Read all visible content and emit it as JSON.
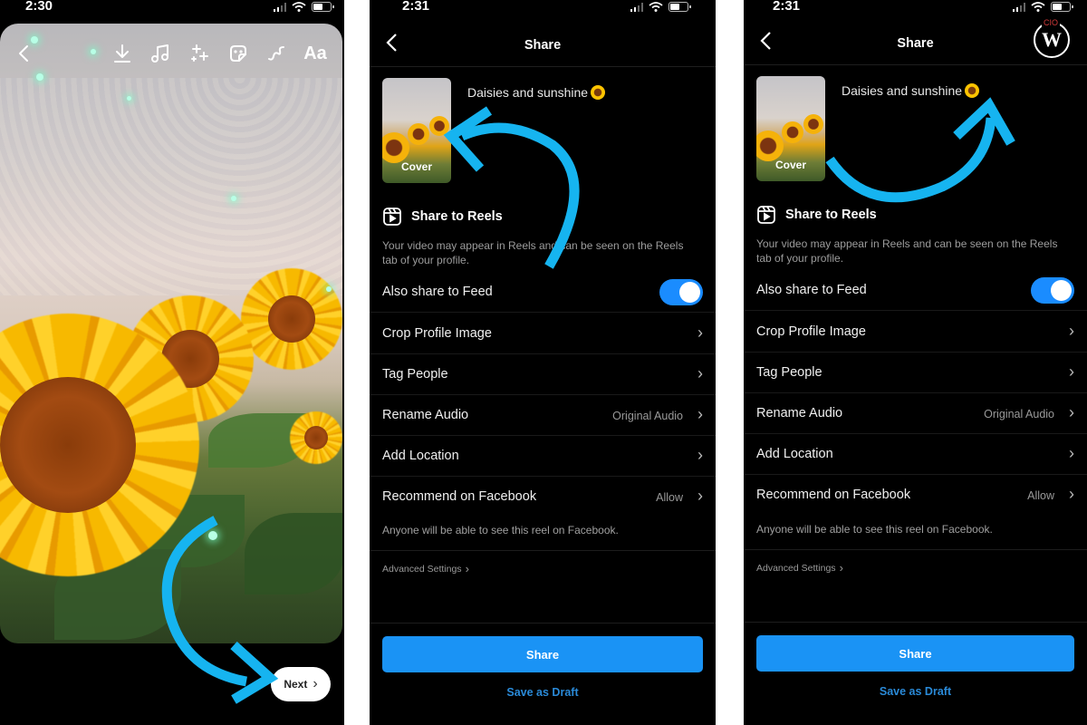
{
  "screens": [
    {
      "id": "story-editor",
      "status": {
        "time": "2:30"
      },
      "toolbar": {
        "back_icon": "chevron-left-icon",
        "tools": [
          {
            "name": "download-icon"
          },
          {
            "name": "music-icon"
          },
          {
            "name": "effects-sparkle-icon"
          },
          {
            "name": "sticker-icon"
          },
          {
            "name": "draw-squiggle-icon"
          },
          {
            "name": "text-tool",
            "label": "Aa"
          }
        ]
      },
      "next_button": {
        "label": "Next",
        "icon": "chevron-right-icon"
      }
    },
    {
      "id": "share-screen-1",
      "status": {
        "time": "2:31"
      },
      "header": {
        "title": "Share"
      },
      "cover_label": "Cover",
      "caption": "Daisies and sunshine",
      "caption_emoji": "sunflower",
      "reels": {
        "title": "Share to Reels",
        "description": "Your video may appear in Reels and can be seen on the Reels tab of your profile."
      },
      "feed_toggle": {
        "label": "Also share to Feed",
        "on": true
      },
      "rows": [
        {
          "label": "Crop Profile Image",
          "value": ""
        },
        {
          "label": "Tag People",
          "value": ""
        },
        {
          "label": "Rename Audio",
          "value": "Original Audio"
        },
        {
          "label": "Add Location",
          "value": ""
        },
        {
          "label": "Recommend on Facebook",
          "value": "Allow"
        }
      ],
      "facebook_note": "Anyone will be able to see this reel on Facebook.",
      "advanced_settings": "Advanced Settings",
      "share_button": "Share",
      "draft_link": "Save as Draft"
    },
    {
      "id": "share-screen-2",
      "status": {
        "time": "2:31"
      },
      "header": {
        "title": "Share"
      },
      "cover_label": "Cover",
      "caption": "Daisies and sunshine",
      "caption_emoji": "sunflower",
      "reels": {
        "title": "Share to Reels",
        "description": "Your video may appear in Reels and can be seen on the Reels tab of your profile."
      },
      "feed_toggle": {
        "label": "Also share to Feed",
        "on": true
      },
      "rows": [
        {
          "label": "Crop Profile Image",
          "value": ""
        },
        {
          "label": "Tag People",
          "value": ""
        },
        {
          "label": "Rename Audio",
          "value": "Original Audio"
        },
        {
          "label": "Add Location",
          "value": ""
        },
        {
          "label": "Recommend on Facebook",
          "value": "Allow"
        }
      ],
      "facebook_note": "Anyone will be able to see this reel on Facebook.",
      "advanced_settings": "Advanced Settings",
      "share_button": "Share",
      "draft_link": "Save as Draft"
    }
  ],
  "watermark": {
    "top_text": "CIO",
    "letter": "W"
  },
  "colors": {
    "accent_blue": "#1a93f5",
    "annotation_arrow": "#16b4f0",
    "toggle_on": "#1a8cff",
    "background": "#000000",
    "watermark_red": "#d23a3a"
  }
}
